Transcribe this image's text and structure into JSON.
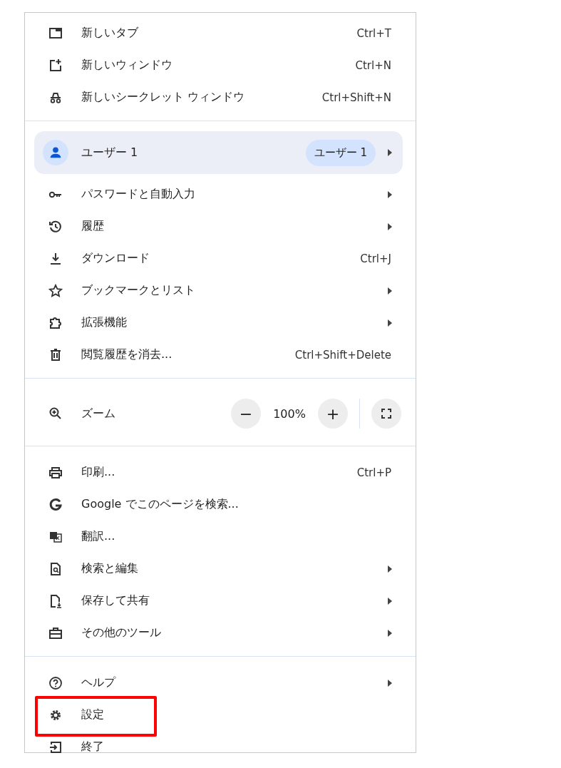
{
  "menu": {
    "sections": [
      {
        "items": [
          {
            "kind": "item",
            "label": "新しいタブ",
            "shortcut": "Ctrl+T",
            "submenu": false,
            "highlighted": false
          },
          {
            "kind": "item",
            "label": "新しいウィンドウ",
            "shortcut": "Ctrl+N",
            "submenu": false,
            "highlighted": false
          },
          {
            "kind": "item",
            "label": "新しいシークレット ウィンドウ",
            "shortcut": "Ctrl+Shift+N",
            "submenu": false,
            "highlighted": false
          }
        ]
      },
      {
        "items": [
          {
            "kind": "profile",
            "label": "ユーザー 1",
            "badge": "ユーザー 1",
            "submenu": true
          },
          {
            "kind": "item",
            "label": "パスワードと自動入力",
            "submenu": true,
            "highlighted": false
          },
          {
            "kind": "item",
            "label": "履歴",
            "submenu": true,
            "highlighted": false
          },
          {
            "kind": "item",
            "label": "ダウンロード",
            "shortcut": "Ctrl+J",
            "submenu": false,
            "highlighted": false
          },
          {
            "kind": "item",
            "label": "ブックマークとリスト",
            "submenu": true,
            "highlighted": false
          },
          {
            "kind": "item",
            "label": "拡張機能",
            "submenu": true,
            "highlighted": false
          },
          {
            "kind": "item",
            "label": "閲覧履歴を消去...",
            "shortcut": "Ctrl+Shift+Delete",
            "submenu": false,
            "highlighted": false
          }
        ]
      },
      {
        "items": [
          {
            "kind": "zoom",
            "label": "ズーム",
            "minus": "−",
            "value": "100%",
            "plus": "+"
          }
        ]
      },
      {
        "items": [
          {
            "kind": "item",
            "label": "印刷...",
            "shortcut": "Ctrl+P",
            "submenu": false,
            "highlighted": false
          },
          {
            "kind": "item",
            "label": "Google でこのページを検索...",
            "submenu": false,
            "highlighted": false
          },
          {
            "kind": "item",
            "label": "翻訳...",
            "submenu": false,
            "highlighted": false
          },
          {
            "kind": "item",
            "label": "検索と編集",
            "submenu": true,
            "highlighted": false
          },
          {
            "kind": "item",
            "label": "保存して共有",
            "submenu": true,
            "highlighted": false
          },
          {
            "kind": "item",
            "label": "その他のツール",
            "submenu": true,
            "highlighted": false
          }
        ]
      },
      {
        "items": [
          {
            "kind": "item",
            "label": "ヘルプ",
            "submenu": true,
            "highlighted": false
          },
          {
            "kind": "item",
            "label": "設定",
            "submenu": false,
            "highlighted": true
          },
          {
            "kind": "item",
            "label": "終了",
            "submenu": false,
            "highlighted": false
          }
        ]
      }
    ]
  }
}
